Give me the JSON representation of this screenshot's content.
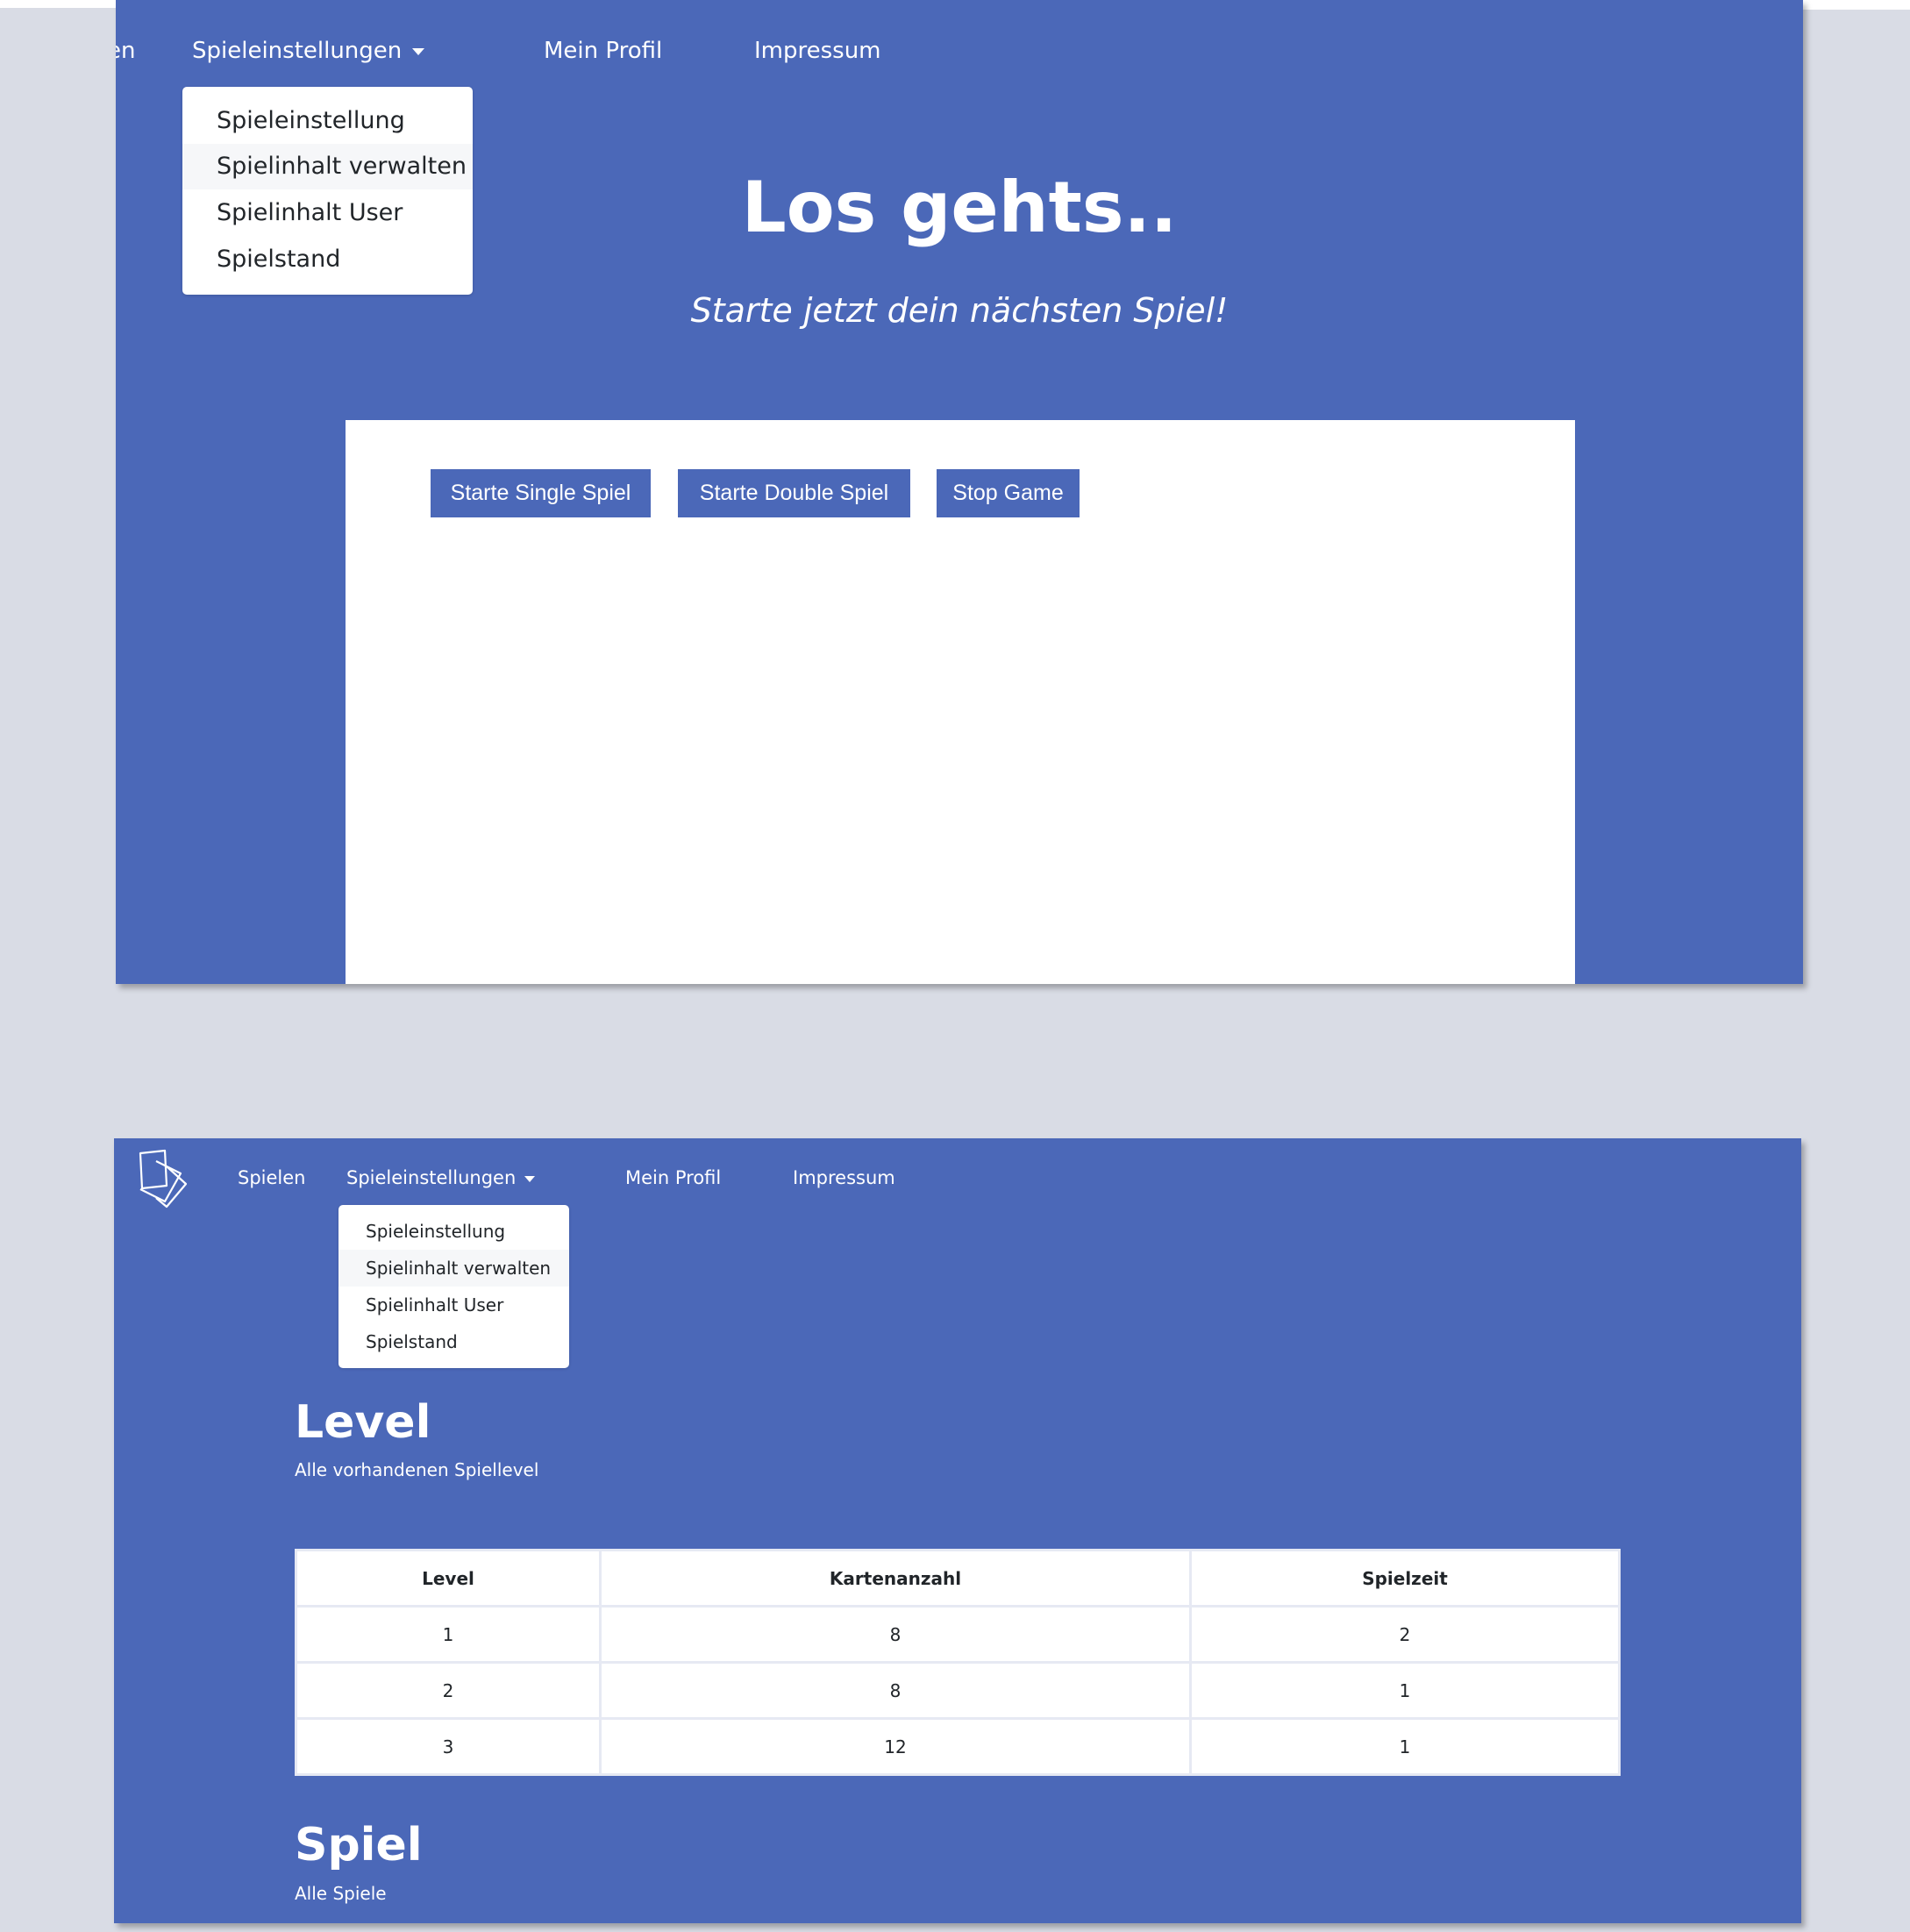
{
  "nav": {
    "spielen": "Spielen",
    "spielen_partial": "en",
    "spieleinstellungen": "Spieleinstellungen",
    "mein_profil": "Mein Profil",
    "impressum": "Impressum"
  },
  "dropdown": {
    "items": [
      "Spieleinstellung",
      "Spielinhalt verwalten",
      "Spielinhalt User",
      "Spielstand"
    ],
    "active_index": 1
  },
  "hero": {
    "title": "Los gehts..",
    "subtitle": "Starte jetzt dein nächsten Spiel!"
  },
  "buttons": {
    "single": "Starte Single Spiel",
    "double": "Starte Double Spiel",
    "stop": "Stop Game"
  },
  "level_section": {
    "title": "Level",
    "subtitle": "Alle vorhandenen Spiellevel"
  },
  "level_table": {
    "headers": [
      "Level",
      "Kartenanzahl",
      "Spielzeit"
    ],
    "rows": [
      [
        "1",
        "8",
        "2"
      ],
      [
        "2",
        "8",
        "1"
      ],
      [
        "3",
        "12",
        "1"
      ]
    ]
  },
  "spiel_section": {
    "title": "Spiel",
    "subtitle": "Alle Spiele"
  },
  "colors": {
    "primary": "#4b68b8",
    "page_background": "#d9dce5",
    "card": "#ffffff",
    "dropdown_active": "#f6f7f9"
  },
  "icons": {
    "logo": "cards-logo-icon",
    "dropdown_caret": "caret-down-icon"
  }
}
